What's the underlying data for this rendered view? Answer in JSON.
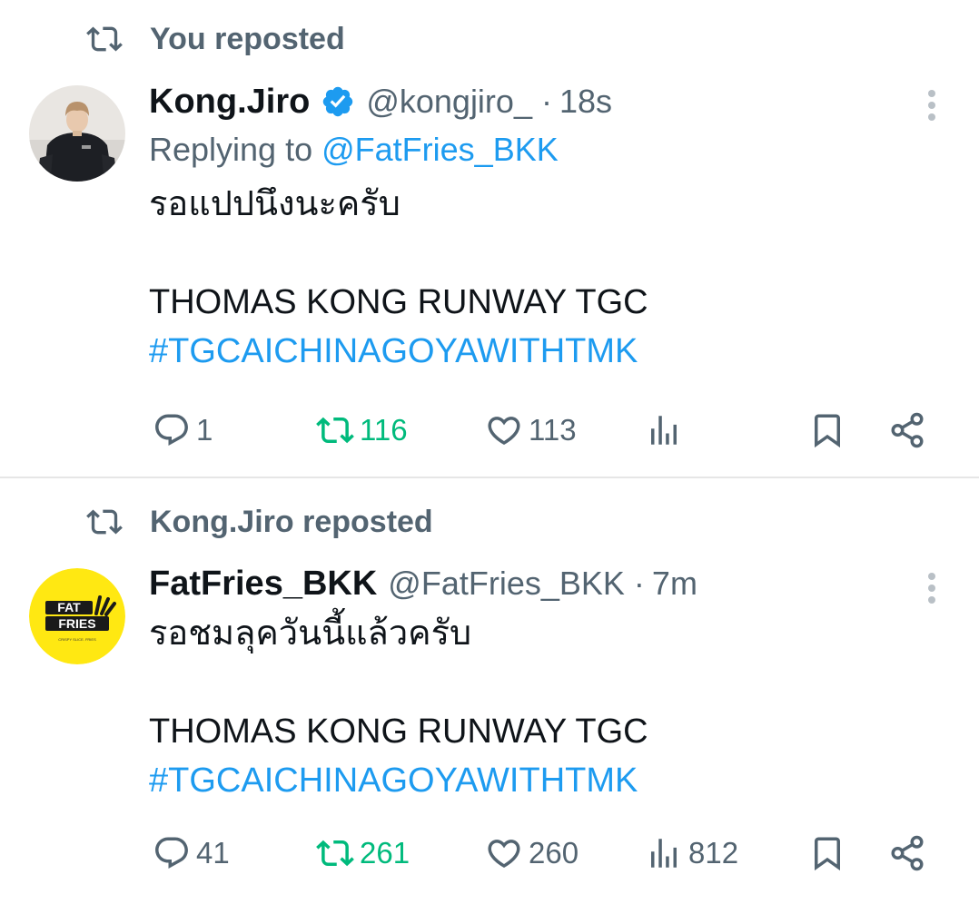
{
  "tweets": [
    {
      "repost_label": "You reposted",
      "author_name": "Kong.Jiro",
      "handle": "@kongjiro_",
      "separator": "·",
      "time": "18s",
      "verified": true,
      "replying_prefix": "Replying to",
      "replying_to": "@FatFries_BKK",
      "text_line1": "รอแปปนึงนะครับ",
      "text_line2": "THOMAS KONG RUNWAY TGC",
      "hashtag": "#TGCAICHINAGOYAWITHTMK",
      "stats": {
        "replies": "1",
        "reposts": "116",
        "likes": "113",
        "views": ""
      },
      "reposted_by_viewer": true
    },
    {
      "repost_label": "Kong.Jiro reposted",
      "author_name": "FatFries_BKK",
      "handle": "@FatFries_BKK",
      "separator": "·",
      "time": "7m",
      "verified": false,
      "text_line1": "รอชมลุควันนี้แล้วครับ",
      "text_line2": "THOMAS KONG RUNWAY TGC",
      "hashtag": "#TGCAICHINAGOYAWITHTMK",
      "stats": {
        "replies": "41",
        "reposts": "261",
        "likes": "260",
        "views": "812"
      },
      "reposted_by_viewer": true,
      "avatar_logo": {
        "line1": "FAT",
        "line2": "FRIES",
        "tagline": "CRISPY SLICE. FRIES"
      }
    }
  ],
  "colors": {
    "primary_text": "#0f1419",
    "secondary_text": "#536471",
    "link_blue": "#1d9bf0",
    "repost_green": "#00ba7c",
    "logo_yellow": "#ffe812"
  },
  "icons": [
    "repost-icon",
    "verified-badge-icon",
    "more-icon",
    "reply-icon",
    "like-icon",
    "views-icon",
    "bookmark-icon",
    "share-icon"
  ]
}
